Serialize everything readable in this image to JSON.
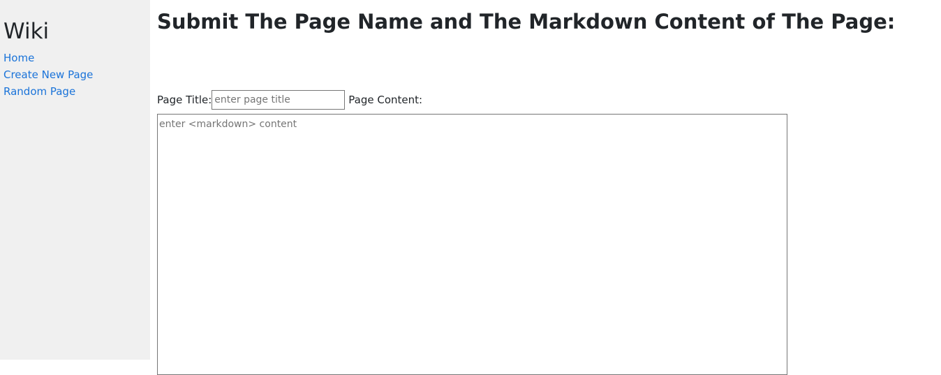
{
  "sidebar": {
    "title": "Wiki",
    "links": [
      {
        "label": "Home"
      },
      {
        "label": "Create New Page"
      },
      {
        "label": "Random Page"
      }
    ]
  },
  "main": {
    "heading": "Submit The Page Name and The Markdown Content of The Page:",
    "form": {
      "title_label": "Page Title:",
      "title_placeholder": "enter page title",
      "title_value": "",
      "content_label": "Page Content:",
      "content_placeholder": "enter <markdown> content",
      "content_value": ""
    }
  },
  "colors": {
    "sidebar_bg": "#f0f0f0",
    "link": "#1a73d9",
    "text": "#212529"
  }
}
